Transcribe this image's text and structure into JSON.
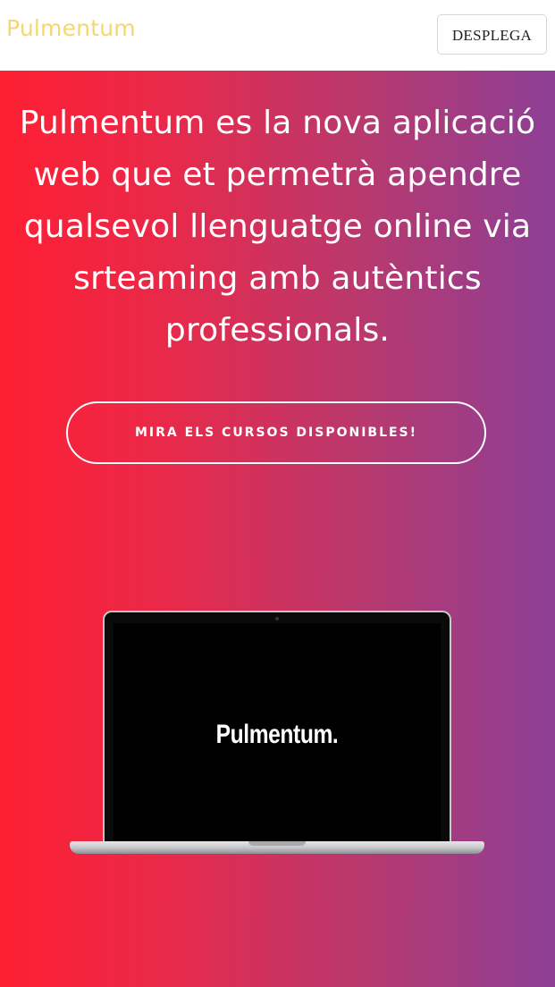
{
  "navbar": {
    "brand": "Pulmentum",
    "toggle_label": "DESPLEGA"
  },
  "hero": {
    "headline": "Pulmentum es la nova aplicació web que et permetrà apendre qualsevol llenguatge online via srteaming amb autèntics professionals.",
    "cta_label": "MIRA ELS CURSOS DISPONIBLES!",
    "laptop_screen_text": "Pulmentum."
  },
  "colors": {
    "brand": "#f5d76e",
    "gradient_start": "#fe1f33",
    "gradient_end": "#8d3f96"
  }
}
